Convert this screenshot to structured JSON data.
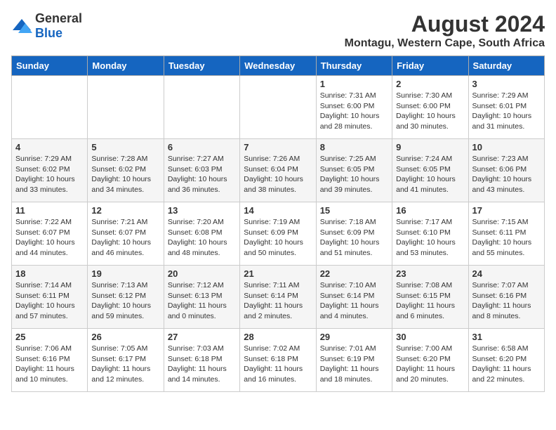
{
  "logo": {
    "text_general": "General",
    "text_blue": "Blue"
  },
  "title": "August 2024",
  "subtitle": "Montagu, Western Cape, South Africa",
  "days_of_week": [
    "Sunday",
    "Monday",
    "Tuesday",
    "Wednesday",
    "Thursday",
    "Friday",
    "Saturday"
  ],
  "weeks": [
    [
      {
        "day": "",
        "info": ""
      },
      {
        "day": "",
        "info": ""
      },
      {
        "day": "",
        "info": ""
      },
      {
        "day": "",
        "info": ""
      },
      {
        "day": "1",
        "info": "Sunrise: 7:31 AM\nSunset: 6:00 PM\nDaylight: 10 hours\nand 28 minutes."
      },
      {
        "day": "2",
        "info": "Sunrise: 7:30 AM\nSunset: 6:00 PM\nDaylight: 10 hours\nand 30 minutes."
      },
      {
        "day": "3",
        "info": "Sunrise: 7:29 AM\nSunset: 6:01 PM\nDaylight: 10 hours\nand 31 minutes."
      }
    ],
    [
      {
        "day": "4",
        "info": "Sunrise: 7:29 AM\nSunset: 6:02 PM\nDaylight: 10 hours\nand 33 minutes."
      },
      {
        "day": "5",
        "info": "Sunrise: 7:28 AM\nSunset: 6:02 PM\nDaylight: 10 hours\nand 34 minutes."
      },
      {
        "day": "6",
        "info": "Sunrise: 7:27 AM\nSunset: 6:03 PM\nDaylight: 10 hours\nand 36 minutes."
      },
      {
        "day": "7",
        "info": "Sunrise: 7:26 AM\nSunset: 6:04 PM\nDaylight: 10 hours\nand 38 minutes."
      },
      {
        "day": "8",
        "info": "Sunrise: 7:25 AM\nSunset: 6:05 PM\nDaylight: 10 hours\nand 39 minutes."
      },
      {
        "day": "9",
        "info": "Sunrise: 7:24 AM\nSunset: 6:05 PM\nDaylight: 10 hours\nand 41 minutes."
      },
      {
        "day": "10",
        "info": "Sunrise: 7:23 AM\nSunset: 6:06 PM\nDaylight: 10 hours\nand 43 minutes."
      }
    ],
    [
      {
        "day": "11",
        "info": "Sunrise: 7:22 AM\nSunset: 6:07 PM\nDaylight: 10 hours\nand 44 minutes."
      },
      {
        "day": "12",
        "info": "Sunrise: 7:21 AM\nSunset: 6:07 PM\nDaylight: 10 hours\nand 46 minutes."
      },
      {
        "day": "13",
        "info": "Sunrise: 7:20 AM\nSunset: 6:08 PM\nDaylight: 10 hours\nand 48 minutes."
      },
      {
        "day": "14",
        "info": "Sunrise: 7:19 AM\nSunset: 6:09 PM\nDaylight: 10 hours\nand 50 minutes."
      },
      {
        "day": "15",
        "info": "Sunrise: 7:18 AM\nSunset: 6:09 PM\nDaylight: 10 hours\nand 51 minutes."
      },
      {
        "day": "16",
        "info": "Sunrise: 7:17 AM\nSunset: 6:10 PM\nDaylight: 10 hours\nand 53 minutes."
      },
      {
        "day": "17",
        "info": "Sunrise: 7:15 AM\nSunset: 6:11 PM\nDaylight: 10 hours\nand 55 minutes."
      }
    ],
    [
      {
        "day": "18",
        "info": "Sunrise: 7:14 AM\nSunset: 6:11 PM\nDaylight: 10 hours\nand 57 minutes."
      },
      {
        "day": "19",
        "info": "Sunrise: 7:13 AM\nSunset: 6:12 PM\nDaylight: 10 hours\nand 59 minutes."
      },
      {
        "day": "20",
        "info": "Sunrise: 7:12 AM\nSunset: 6:13 PM\nDaylight: 11 hours\nand 0 minutes."
      },
      {
        "day": "21",
        "info": "Sunrise: 7:11 AM\nSunset: 6:14 PM\nDaylight: 11 hours\nand 2 minutes."
      },
      {
        "day": "22",
        "info": "Sunrise: 7:10 AM\nSunset: 6:14 PM\nDaylight: 11 hours\nand 4 minutes."
      },
      {
        "day": "23",
        "info": "Sunrise: 7:08 AM\nSunset: 6:15 PM\nDaylight: 11 hours\nand 6 minutes."
      },
      {
        "day": "24",
        "info": "Sunrise: 7:07 AM\nSunset: 6:16 PM\nDaylight: 11 hours\nand 8 minutes."
      }
    ],
    [
      {
        "day": "25",
        "info": "Sunrise: 7:06 AM\nSunset: 6:16 PM\nDaylight: 11 hours\nand 10 minutes."
      },
      {
        "day": "26",
        "info": "Sunrise: 7:05 AM\nSunset: 6:17 PM\nDaylight: 11 hours\nand 12 minutes."
      },
      {
        "day": "27",
        "info": "Sunrise: 7:03 AM\nSunset: 6:18 PM\nDaylight: 11 hours\nand 14 minutes."
      },
      {
        "day": "28",
        "info": "Sunrise: 7:02 AM\nSunset: 6:18 PM\nDaylight: 11 hours\nand 16 minutes."
      },
      {
        "day": "29",
        "info": "Sunrise: 7:01 AM\nSunset: 6:19 PM\nDaylight: 11 hours\nand 18 minutes."
      },
      {
        "day": "30",
        "info": "Sunrise: 7:00 AM\nSunset: 6:20 PM\nDaylight: 11 hours\nand 20 minutes."
      },
      {
        "day": "31",
        "info": "Sunrise: 6:58 AM\nSunset: 6:20 PM\nDaylight: 11 hours\nand 22 minutes."
      }
    ]
  ]
}
